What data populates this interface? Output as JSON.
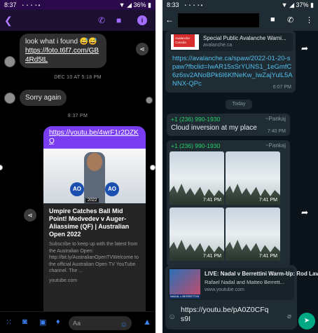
{
  "messenger": {
    "status": {
      "time": "8:37",
      "icons_left": "◔ ◔ ◔ ◔ •",
      "battery": "36%"
    },
    "messages": {
      "msg1_text": "look what i found 😅😅",
      "msg1_link": "https://foto.t6f7.com/GB4Rd5tL",
      "timestamp1": "DEC 10 AT 5:18 PM",
      "msg2_text": "Sorry again",
      "timestamp2": "8:37 PM"
    },
    "card": {
      "link": "https://youtu.be/4wrF1r2DZKQ",
      "year_badge": "2022",
      "title": "Umpire Catches Ball Mid Point! Medvedev v Auger-Aliassime (QF) | Australian Open 2022",
      "description": "Subscribe to keep up with the latest from the Australian Open: http://bit.ly/AustralianOpenTVWelcome to the official Australian Open TV YouTube channel. The ...",
      "domain": "youtube.com"
    },
    "composer": {
      "placeholder": "Aa"
    }
  },
  "whatsapp": {
    "status": {
      "time": "8:33",
      "battery": "37%"
    },
    "preview": {
      "logo_text": "Avalanche Canada",
      "title": "Special Public Avalanche Warni...",
      "domain": "avalanche.ca",
      "link": "https://avalanche.ca/spaw/2022-01-20-spaw?fbclid=IwAR15sSrYUNS1_1eGmfC6z6sv2ANoBPk6I6KfNeKw_IwZajYulL5ANNX-QPc",
      "time": "6:07 PM"
    },
    "date_chip": "Today",
    "msg1": {
      "phone": "+1 (236) 990-1930",
      "name": "~Pankaj",
      "text": "Cloud inversion at my place",
      "time": "7:40 PM"
    },
    "msg2": {
      "phone": "+1 (236) 990-1930",
      "name": "~Pankaj",
      "photo_times": [
        "7:41 PM",
        "7:41 PM",
        "7:41 PM",
        "7:41 PM"
      ]
    },
    "composer": {
      "quote_title": "LIVE: Nadal v Berrettini Warm-Up: Rod Laver Are...",
      "quote_subtitle": "Rafael Nadal and Matteo Berrett...",
      "quote_domain": "www.youtube.com",
      "quote_thumb_tag": "NADAL v BERRETTINI",
      "text": "https://youtu.be/pA0Z0CFqs9I"
    }
  }
}
